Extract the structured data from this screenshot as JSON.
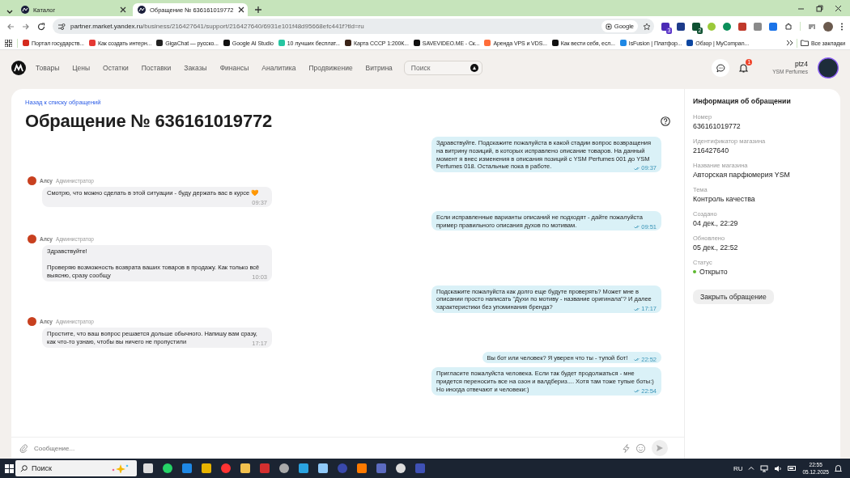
{
  "browser": {
    "tabs": [
      {
        "title": "Каталог",
        "selected": false
      },
      {
        "title": "Обращение № 636161019772",
        "selected": true
      }
    ],
    "url": {
      "host": "partner.market.yandex.ru",
      "path": "/business/216427641/support/216427640/6931e101f48d95668efc441f?tld=ru"
    },
    "search_chip": "Google",
    "extension_badges": [
      "3",
      "2"
    ],
    "bookmarks": [
      "Портал государств...",
      "Как создать интерн...",
      "GigaChat — русско...",
      "Google AI Studio",
      "10 лучших бесплат...",
      "Карта СССР 1:200К...",
      "SAVEVIDEO.ME - Ск...",
      "Аренда VPS и VDS...",
      "Как вести себя, есл...",
      "IsFusion | Платфор...",
      "Обзор | MyCompan..."
    ],
    "all_bookmarks": "Все закладки"
  },
  "app": {
    "nav": [
      "Товары",
      "Цены",
      "Остатки",
      "Поставки",
      "Заказы",
      "Финансы",
      "Аналитика",
      "Продвижение",
      "Витрина"
    ],
    "search": {
      "placeholder": "Поиск"
    },
    "notifications": "1",
    "user": "ptz4",
    "store": "YSM Perfumes"
  },
  "ticket": {
    "back_link": "Назад к списку обращений",
    "title": "Обращение № 636161019772",
    "messages": [
      {
        "kind": "outgoing",
        "text": "Здравствуйте. Подскажите пожалуйста в какой стадии вопрос возвращения на витрину позиций, в которых исправлено описание товаров. На данный момент я внес изменения в описания позиций с YSM Perfumes 001 до YSM Perfumes 018. Остальные пока в работе.",
        "time": "09:37",
        "read": true
      },
      {
        "kind": "incoming",
        "author": "Алсу",
        "role": "Администратор",
        "text": "Смотрю, что можно сделать в этой ситуации - буду держать вас в курсе 🧡",
        "time": "09:37"
      },
      {
        "kind": "outgoing",
        "text": "Если исправленные варианты описаний не подходят - дайте пожалуйста пример правильного описания духов по мотивам.",
        "time": "09:51",
        "read": true
      },
      {
        "kind": "incoming",
        "author": "Алсу",
        "role": "Администратор",
        "text": "Здравствуйте!\n\nПроверяю возможность возврата ваших товаров в продажу. Как только всё выясню, сразу сообщу",
        "time": "10:03"
      },
      {
        "kind": "outgoing",
        "text": "Подскажите пожалуйста как долго еще будуте проверять? Может мне в описании просто написать \"Духи по мотиву - название оригинала\"? И далее характеристики без упоминания бренда?",
        "time": "17:17",
        "read": true
      },
      {
        "kind": "incoming",
        "author": "Алсу",
        "role": "Администратор",
        "text": "Простите, что ваш вопрос решается дольше обычного. Напишу вам сразу, как что-то узнаю, чтобы вы ничего не пропустили",
        "time": "17:17"
      },
      {
        "kind": "outgoing",
        "text": "Вы бот или человек? Я уверен что ты - тупой бот!",
        "time": "22:52",
        "read": true
      },
      {
        "kind": "outgoing",
        "text": "Пригласите пожалуйста человека. Если так будет продолжаться - мне придется переносить все на озон и валдбериз.... Хотя там тоже тупые боты:) Но иногда отвечают и человеки:)",
        "time": "22:54",
        "read": true
      }
    ],
    "composer": {
      "placeholder": "Сообщение..."
    }
  },
  "info": {
    "heading": "Информация об обращении",
    "fields": [
      {
        "label": "Номер",
        "value": "636161019772"
      },
      {
        "label": "Идентификатор магазина",
        "value": "216427640"
      },
      {
        "label": "Название магазина",
        "value": "Авторская парфюмерия YSM"
      },
      {
        "label": "Тема",
        "value": "Контроль качества"
      },
      {
        "label": "Создано",
        "value": "04 дек., 22:29"
      },
      {
        "label": "Обновлено",
        "value": "05 дек., 22:52"
      }
    ],
    "status": {
      "label": "Статус",
      "value": "Открыто",
      "color": "#5cb82e"
    },
    "close_button": "Закрыть обращение"
  },
  "taskbar": {
    "search": {
      "placeholder": "Поиск"
    },
    "language": "RU",
    "time": "22:55",
    "date": "05.12.2025"
  }
}
